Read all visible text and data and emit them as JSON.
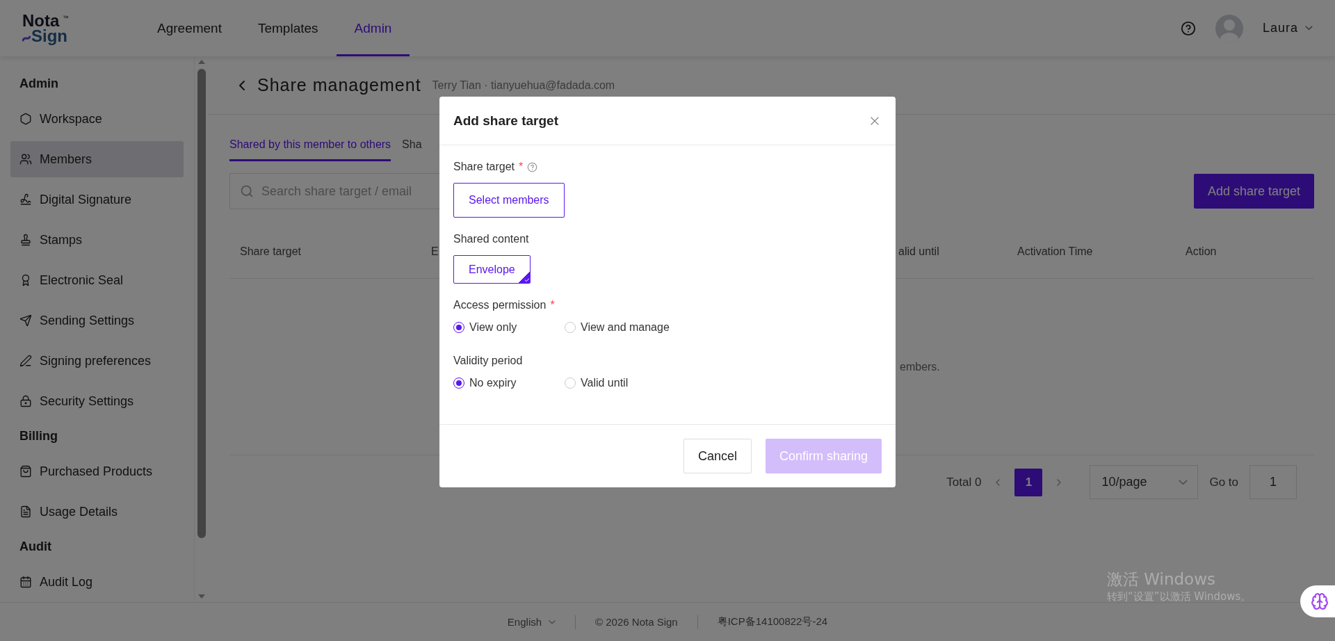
{
  "topbar": {
    "logo": {
      "line1": "Nota",
      "line2": "Sign",
      "mark": "™"
    },
    "nav": [
      {
        "label": "Agreement",
        "selected": false
      },
      {
        "label": "Templates",
        "selected": false
      },
      {
        "label": "Admin",
        "selected": true
      }
    ],
    "user": {
      "name": "Laura"
    }
  },
  "sidebar": {
    "sections": [
      {
        "title": "Admin",
        "items": [
          {
            "label": "Workspace",
            "selected": false
          },
          {
            "label": "Members",
            "selected": true
          },
          {
            "label": "Digital Signature",
            "selected": false
          },
          {
            "label": "Stamps",
            "selected": false
          },
          {
            "label": "Electronic Seal",
            "selected": false
          },
          {
            "label": "Sending Settings",
            "selected": false
          },
          {
            "label": "Signing preferences",
            "selected": false
          },
          {
            "label": "Security Settings",
            "selected": false
          }
        ]
      },
      {
        "title": "Billing",
        "items": [
          {
            "label": "Purchased Products",
            "selected": false
          },
          {
            "label": "Usage Details",
            "selected": false
          }
        ]
      },
      {
        "title": "Audit",
        "items": [
          {
            "label": "Audit Log",
            "selected": false
          }
        ]
      }
    ]
  },
  "page": {
    "title": "Share management",
    "subtitle": "Terry Tian · tianyuehua@fadada.com",
    "tabs": [
      {
        "label": "Shared by this member to others",
        "selected": true
      },
      {
        "label": "Sha",
        "selected": false
      }
    ],
    "search": {
      "placeholder": "Search share target / email"
    },
    "add_button": "Add share target",
    "table": {
      "columns": [
        "Share target",
        "E",
        "alid until",
        "Activation Time",
        "Action"
      ],
      "empty_text": "embers."
    },
    "pagination": {
      "total": "Total 0",
      "pages": [
        {
          "label": "1",
          "selected": true
        }
      ],
      "page_size": "10/page",
      "goto_label": "Go to",
      "goto_value": "1"
    }
  },
  "footer": {
    "language": "English",
    "copyright": "© 2026 Nota Sign",
    "icp": "粤ICP备14100822号-24"
  },
  "modal": {
    "title": "Add share target",
    "share_target": {
      "label": "Share target",
      "required_mark": "*",
      "button": "Select members"
    },
    "shared_content": {
      "label": "Shared content",
      "options": [
        {
          "label": "Envelope",
          "selected": true
        }
      ]
    },
    "access": {
      "label": "Access permission",
      "required_mark": "*",
      "options": [
        {
          "label": "View only",
          "selected": true
        },
        {
          "label": "View and manage",
          "selected": false
        }
      ]
    },
    "validity": {
      "label": "Validity period",
      "options": [
        {
          "label": "No expiry",
          "selected": true
        },
        {
          "label": "Valid until",
          "selected": false
        }
      ]
    },
    "cancel": "Cancel",
    "confirm": {
      "label": "Confirm sharing",
      "disabled": true
    }
  },
  "os_notice": {
    "title": "激活 Windows",
    "text": "转到“设置”以激活 Windows。"
  }
}
